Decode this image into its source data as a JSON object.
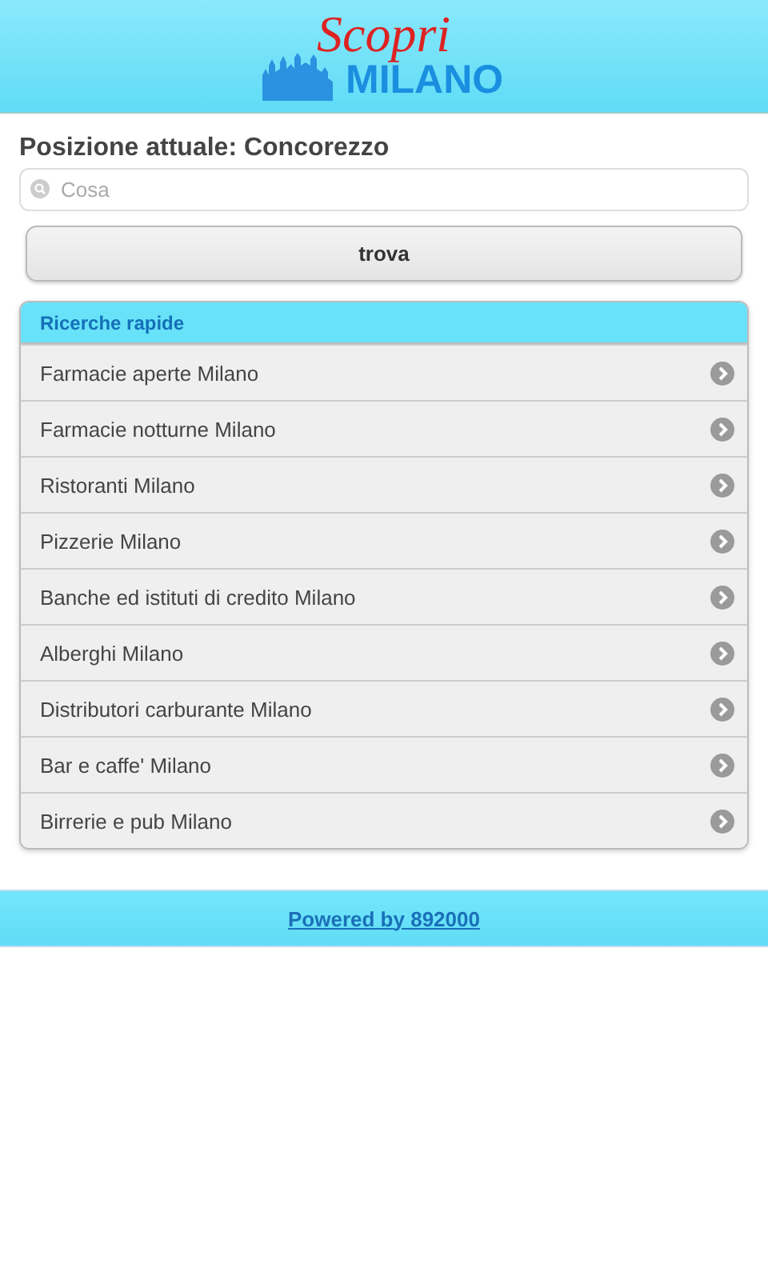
{
  "header": {
    "logo_script": "Scopri",
    "logo_city": "MILANO"
  },
  "location_title": "Posizione attuale: Concorezzo",
  "search": {
    "placeholder": "Cosa"
  },
  "search_button": "trova",
  "quick_searches": {
    "title": "Ricerche rapide",
    "items": [
      "Farmacie aperte Milano",
      "Farmacie notturne Milano",
      "Ristoranti Milano",
      "Pizzerie Milano",
      "Banche ed istituti di credito Milano",
      "Alberghi Milano",
      "Distributori carburante Milano",
      "Bar e caffe' Milano",
      "Birrerie e pub Milano"
    ]
  },
  "footer": {
    "link": "Powered by 892000"
  }
}
